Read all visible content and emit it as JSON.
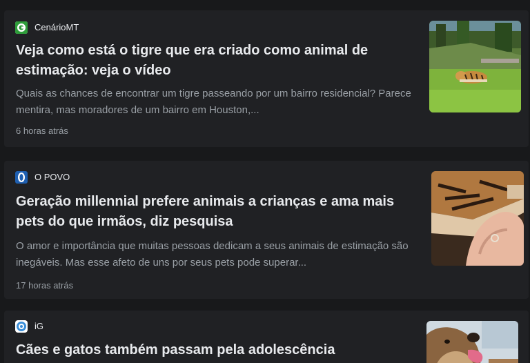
{
  "articles": [
    {
      "source": "CenárioMT",
      "logo_icon": "cenariomt-logo-icon",
      "logo_color": "#2e9d3a",
      "title": "Veja como está o tigre que era criado como animal de estimação: veja o vídeo",
      "snippet": "Quais as chances de encontrar um tigre passeando por um bairro residencial? Parece mentira, mas moradores de um bairro em Houston,...",
      "time": "6 horas atrás",
      "image": "tiger-in-grass-image"
    },
    {
      "source": "O POVO",
      "logo_icon": "opovo-logo-icon",
      "logo_color": "#1f5fb0",
      "title": "Geração millennial prefere animais a crianças e ama mais pets do que irmãos, diz pesquisa",
      "snippet": "O amor e importância que muitas pessoas dedicam a seus animais de estimação são inegáveis. Mas esse afeto de uns por seus pets pode superar...",
      "time": "17 horas atrás",
      "image": "hand-holding-cat-paw-image"
    },
    {
      "source": "iG",
      "logo_icon": "ig-logo-icon",
      "logo_color": "#3b8fd9",
      "title": "Cães e gatos também passam pela adolescência",
      "image": "dog-closeup-image"
    }
  ]
}
